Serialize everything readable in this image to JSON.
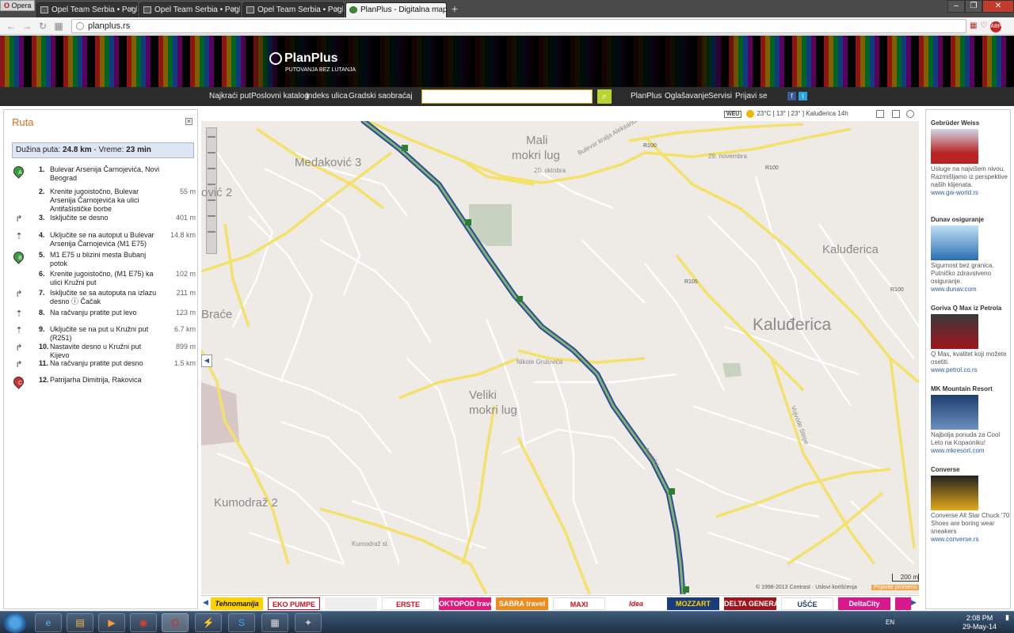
{
  "browser": {
    "app_button": "Opera",
    "tabs": [
      {
        "label": "Opel Team Serbia • Pogle"
      },
      {
        "label": "Opel Team Serbia • Pogle"
      },
      {
        "label": "Opel Team Serbia • Poglje"
      },
      {
        "label": "PlanPlus - Digitalna mapa"
      }
    ],
    "url": "planplus.rs"
  },
  "site": {
    "logo": "PlanPlus",
    "tagline": "PUTOVANJA BEZ LUTANJA",
    "menu_left": [
      "Najkraći put",
      "Poslovni katalog",
      "Indeks ulica",
      "Gradski saobraćaj"
    ],
    "menu_right": [
      "PlanPlus",
      "Oglašavanje",
      "Servisi",
      "Prijavi se"
    ],
    "search_value": ""
  },
  "route": {
    "title": "Ruta",
    "summary_prefix": "Dužina puta:",
    "length": "24.8 km",
    "time_prefix": "- Vreme:",
    "time": "23 min",
    "steps": [
      {
        "num": "1.",
        "text": "Bulevar Arsenija Čarnojevića, Novi Beograd",
        "dist": "",
        "icon": "A"
      },
      {
        "num": "2.",
        "text": "Krenite jugoistočno, Bulevar Arsenija Čarnojevića ka ulici Antifašističke borbe",
        "dist": "55 m",
        "icon": ""
      },
      {
        "num": "3.",
        "text": "Isključite se desno",
        "dist": "401 m",
        "icon": "↱"
      },
      {
        "num": "4.",
        "text": "Uključite se na autoput u Bulevar Arsenija Čarnojevića (M1 E75)",
        "dist": "14.8 km",
        "icon": "⇡"
      },
      {
        "num": "5.",
        "text": "M1 E75 u blizini mesta Bubanj potok",
        "dist": "",
        "icon": "B"
      },
      {
        "num": "6.",
        "text": "Krenite jugoistočno, (M1 E75) ka ulici Kružni put",
        "dist": "102 m",
        "icon": ""
      },
      {
        "num": "7.",
        "text": "Isključite se sa autoputa na izlazu desno ⓘ Čačak",
        "dist": "211 m",
        "icon": "↱"
      },
      {
        "num": "8.",
        "text": "Na račvanju pratite put levo",
        "dist": "123 m",
        "icon": "⇡"
      },
      {
        "num": "9.",
        "text": "Uključite se na put u Kružni put (R251)",
        "dist": "6.7 km",
        "icon": "⇡"
      },
      {
        "num": "10.",
        "text": "Nastavite desno u Kružni put Kijevo",
        "dist": "899 m",
        "icon": "↱"
      },
      {
        "num": "11.",
        "text": "Na račvanju pratite put desno",
        "dist": "1.5 km",
        "icon": "↱"
      },
      {
        "num": "12.",
        "text": "Patrijarha Dimitrija, Rakovica",
        "dist": "",
        "icon": "C"
      }
    ]
  },
  "map": {
    "weather": {
      "brand": "WEU",
      "temp": "23°C",
      "range": "[ 13° | 23° ]",
      "place": "Kaluđerica 14h"
    },
    "labels": {
      "mali": "Mali",
      "mokri_lug": "mokri lug",
      "kaludjerica": "Kaluđerica",
      "kaludjerica_small": "Kaluđerica",
      "veliki": "Veliki",
      "veliki_mokri": "mokri lug",
      "kumodraz": "Kumodraž 2",
      "medakovic": "Medaković 3",
      "vic": "ović 2",
      "brace": "Braće",
      "bulevar": "Bulevar kralja Aleksandra",
      "oktobra": "20. oktobra",
      "novembra": "29. novembra",
      "nikole": "Nikole Grulovića",
      "vojvode": "Vojvode Stepe",
      "avala": "Avalska",
      "kumodraz_st": "Kumodraž st.",
      "r100": "R100",
      "r100b": "R100",
      "r100c": "R100",
      "r105": "R105"
    },
    "scale": "200 m",
    "copyright": "© 1998-2013 Contrast · Uslovi korišćenja",
    "report": "Prijavite promenu"
  },
  "ads_bar": [
    "Tehnomanija",
    "EKO PUMPE",
    "",
    "ERSTE",
    "OKTOPOD travel",
    "SABRA travel",
    "MAXI",
    "Idea",
    "MOZZART",
    "DELTA GENERALI",
    "UŠĆE",
    "DeltaCity"
  ],
  "right_ads": [
    {
      "title": "Gebrüder Weiss",
      "desc": "Usluge na najvišem nivou. Razmišljamo iz perspektive naših klijenata.",
      "url": "www.gw-world.rs",
      "color": "#b22"
    },
    {
      "title": "Dunav osiguranje",
      "desc": "Sigurnost bez granica. Putničko zdravstveno osiguranje.",
      "url": "www.dunav.com",
      "color": "#2a6fb5"
    },
    {
      "title": "Goriva Q Max iz Petrola",
      "desc": "Q Max, kvalitet koji možete osetiti.",
      "url": "www.petrol.co.rs",
      "color": "#a1141c"
    },
    {
      "title": "MK Mountain Resort",
      "desc": "Najbolja ponuda za Cool Leto na Kopaoniku!",
      "url": "www.mkresort.com",
      "color": "#1f3f6e"
    },
    {
      "title": "Converse",
      "desc": "Converse All Star Chuck '70 Shoes are boring wear sneakers",
      "url": "www.converse.rs",
      "color": "#e3a91a"
    }
  ],
  "taskbar": {
    "lang": "EN",
    "time": "2:08 PM",
    "date": "29-May-14"
  }
}
